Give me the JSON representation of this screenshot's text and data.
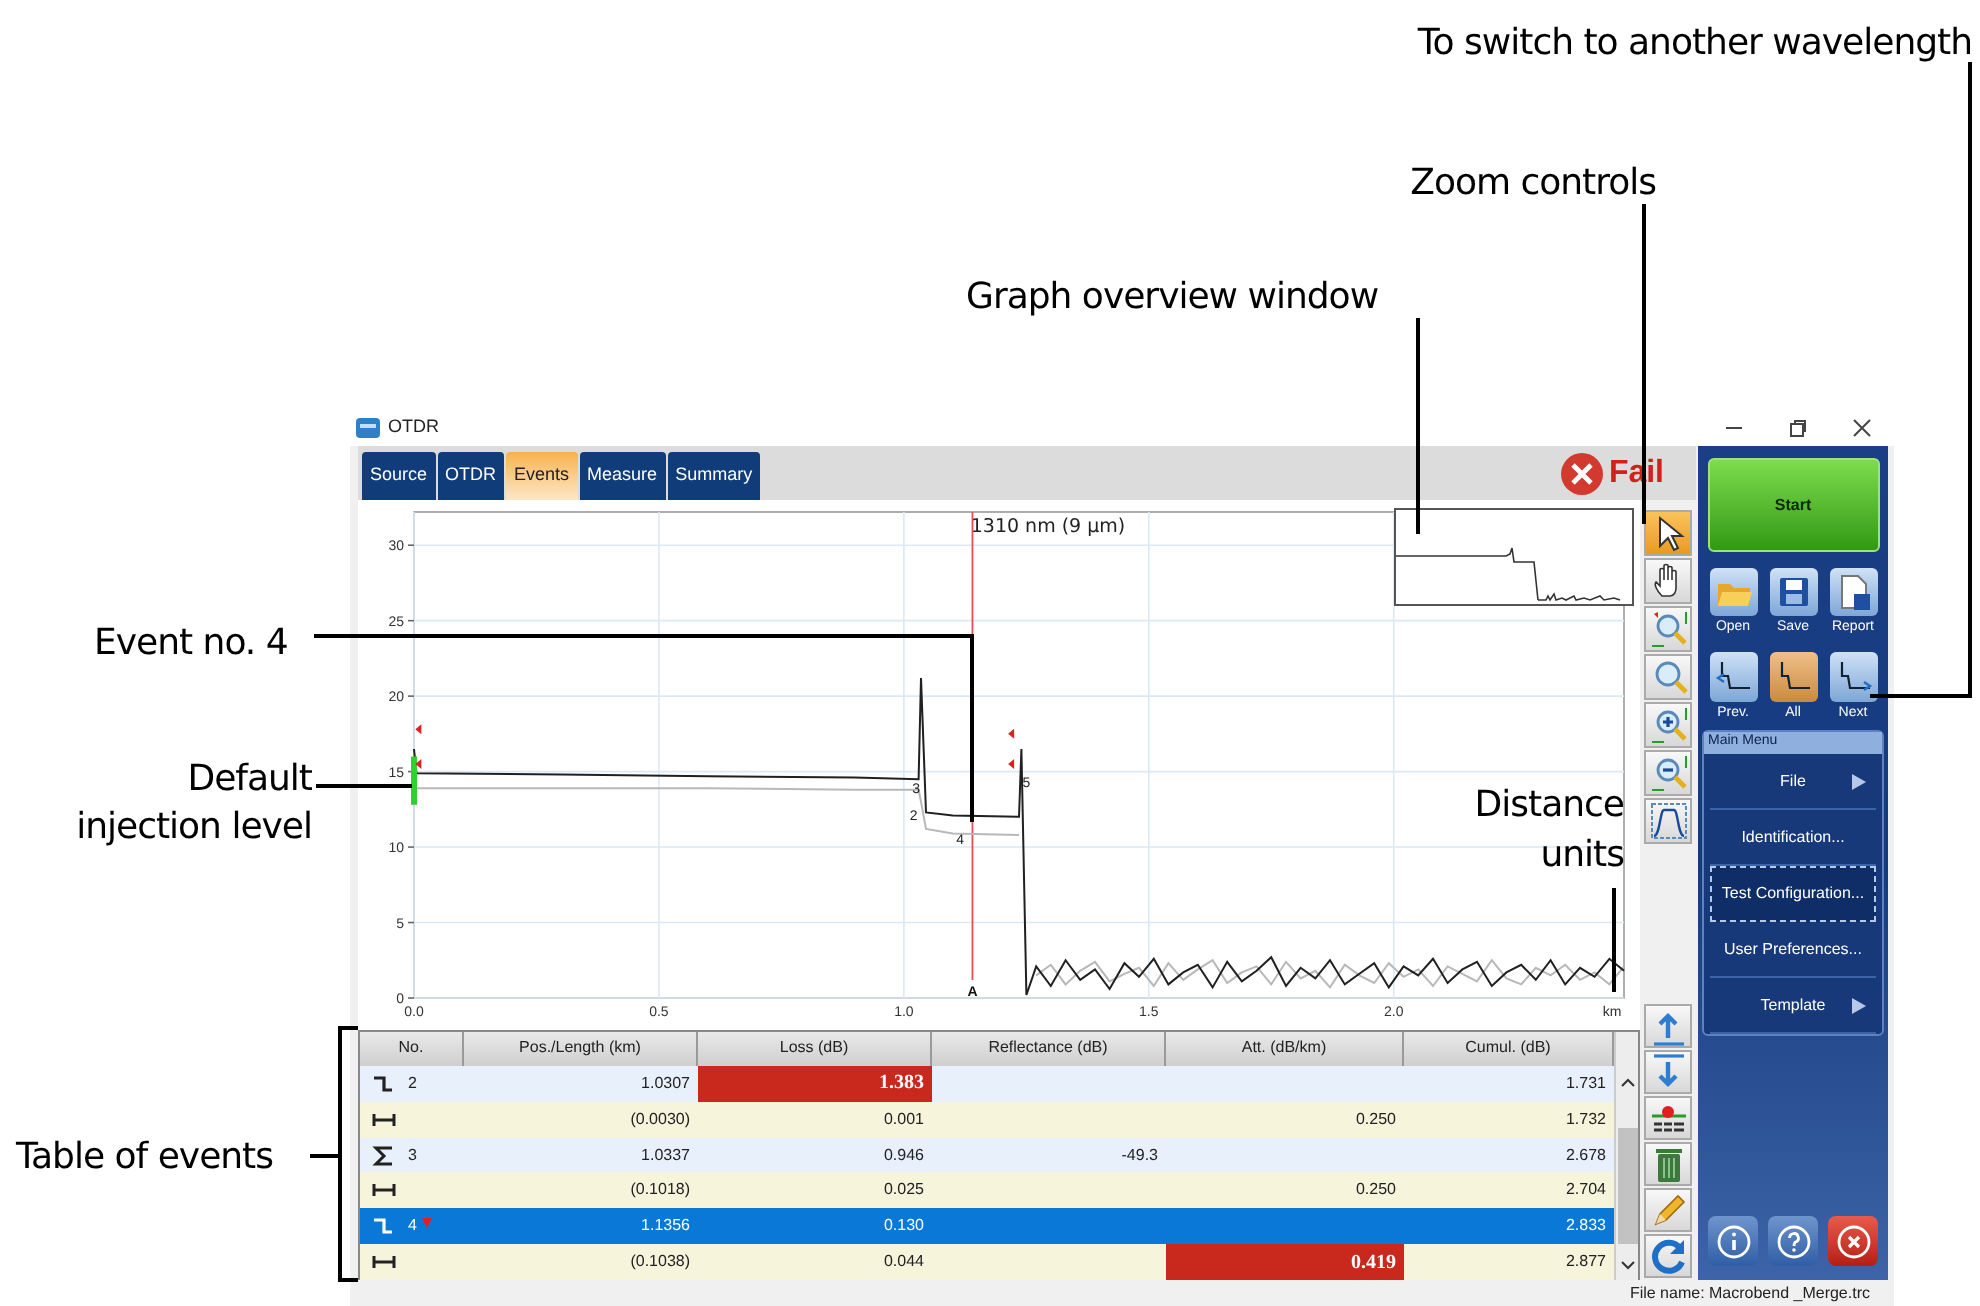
{
  "callouts": [
    {
      "kind": "wavelength",
      "text": "To switch to another wavelength"
    },
    {
      "kind": "zoom",
      "text": "Zoom controls"
    },
    {
      "kind": "overview",
      "text": "Graph overview window"
    },
    {
      "kind": "event",
      "text": "Event no. 4"
    },
    {
      "kind": "injection",
      "text": "Default injection level"
    },
    {
      "kind": "units",
      "text": "Distance units"
    },
    {
      "kind": "table",
      "text": "Table of events"
    }
  ],
  "window": {
    "title": "OTDR"
  },
  "tabs": [
    {
      "label": "Source",
      "selected": false
    },
    {
      "label": "OTDR",
      "selected": false
    },
    {
      "label": "Events",
      "selected": true
    },
    {
      "label": "Measure",
      "selected": false
    },
    {
      "label": "Summary",
      "selected": false
    }
  ],
  "status": {
    "label": "Fail"
  },
  "graph": {
    "chart_data": {
      "type": "line",
      "title": "1310 nm (9 µm)",
      "xlabel": "km",
      "xlim": [
        0,
        2.47
      ],
      "ylim": [
        0,
        32.2
      ],
      "grid": true,
      "xticks": [
        {
          "value": 0,
          "label": "0.0"
        },
        {
          "value": 0.5,
          "label": "0.5"
        },
        {
          "value": 1,
          "label": "1.0"
        },
        {
          "value": 1.5,
          "label": "1.5"
        },
        {
          "value": 2,
          "label": "2.0"
        }
      ],
      "yticks": [
        0,
        5,
        10,
        15,
        20,
        25,
        30
      ],
      "x": [
        0,
        0.005,
        0.3,
        0.6,
        0.9,
        1.03,
        1.035,
        1.045,
        1.1,
        1.235,
        1.24,
        1.25,
        1.27,
        1.3,
        1.33,
        1.36,
        1.39,
        1.42,
        1.45,
        1.48,
        1.51,
        1.54,
        1.57,
        1.6,
        1.63,
        1.66,
        1.69,
        1.72,
        1.75,
        1.78,
        1.81,
        1.84,
        1.87,
        1.9,
        1.93,
        1.96,
        1.99,
        2.02,
        2.05,
        2.08,
        2.11,
        2.14,
        2.17,
        2.2,
        2.23,
        2.26,
        2.29,
        2.32,
        2.35,
        2.38,
        2.41,
        2.44,
        2.47
      ],
      "series": [
        {
          "color": "#b8b8b8",
          "values": [
            14.0,
            13.9,
            13.9,
            13.9,
            13.8,
            13.8,
            13.0,
            11.2,
            10.9,
            10.8,
            null,
            null,
            1.5,
            2.2,
            0.9,
            1.8,
            2.4,
            1.1,
            1.6,
            2.0,
            0.8,
            2.3,
            1.2,
            1.9,
            2.5,
            1.0,
            1.7,
            2.1,
            0.9,
            2.4,
            1.3,
            1.8,
            0.7,
            2.2,
            1.5,
            1.0,
            2.3,
            1.4,
            1.9,
            0.8,
            2.1,
            1.6,
            1.1,
            2.5,
            1.3,
            0.9,
            2.0,
            1.5,
            2.2,
            1.2,
            1.7,
            0.9,
            2.1
          ]
        },
        {
          "color": "#202020",
          "values": [
            16.5,
            14.9,
            14.8,
            14.7,
            14.6,
            14.5,
            21.2,
            12.3,
            12.1,
            12.0,
            16.5,
            0.2,
            2.1,
            0.8,
            2.5,
            1.2,
            1.9,
            0.6,
            2.3,
            1.4,
            2.6,
            0.9,
            1.7,
            2.2,
            0.7,
            2.4,
            1.1,
            1.8,
            2.7,
            0.8,
            2.0,
            1.3,
            2.5,
            0.9,
            1.6,
            2.3,
            0.7,
            2.1,
            1.5,
            2.6,
            1.0,
            1.9,
            2.4,
            0.8,
            1.7,
            2.2,
            1.2,
            2.5,
            0.9,
            2.0,
            1.4,
            2.6,
            1.8
          ]
        }
      ],
      "ref_lines": [
        {
          "axis": "x",
          "value": 1.14,
          "label": "A",
          "color": "#e05050"
        }
      ],
      "annotations": [
        {
          "x": 1.02,
          "y": 11.8,
          "text": "2"
        },
        {
          "x": 1.025,
          "y": 13.6,
          "text": "3"
        },
        {
          "x": 1.115,
          "y": 10.2,
          "text": "4"
        },
        {
          "x": 1.25,
          "y": 14.0,
          "text": "5"
        }
      ]
    }
  },
  "zoom_tools": [
    {
      "kind": "pointer",
      "selected": true
    },
    {
      "kind": "hand",
      "selected": false
    },
    {
      "kind": "zoom-area",
      "selected": false
    },
    {
      "kind": "zoom-reset",
      "selected": false
    },
    {
      "kind": "zoom-in",
      "selected": false
    },
    {
      "kind": "zoom-out",
      "selected": false
    },
    {
      "kind": "full-view",
      "selected": false
    }
  ],
  "table_tools": [
    {
      "kind": "up"
    },
    {
      "kind": "down"
    },
    {
      "kind": "insert"
    },
    {
      "kind": "delete"
    },
    {
      "kind": "edit"
    },
    {
      "kind": "refresh"
    }
  ],
  "events_table": {
    "columns": [
      "No.",
      "Pos./Length (km)",
      "Loss (dB)",
      "Reflectance (dB)",
      "Att. (dB/km)",
      "Cumul. (dB)"
    ],
    "rows": [
      {
        "kind": "step",
        "number": "2",
        "flagged": false,
        "selected": false,
        "cells": [
          {
            "text": "1.0307",
            "fail": false
          },
          {
            "text": "1.383",
            "fail": true
          },
          null,
          null,
          {
            "text": "1.731",
            "fail": false
          }
        ]
      },
      {
        "kind": "span",
        "flagged": false,
        "selected": false,
        "cells": [
          {
            "text": "(0.0030)",
            "fail": false
          },
          {
            "text": "0.001",
            "fail": false
          },
          null,
          {
            "text": "0.250",
            "fail": false
          },
          {
            "text": "1.732",
            "fail": false
          }
        ]
      },
      {
        "kind": "merged",
        "number": "3",
        "flagged": false,
        "selected": false,
        "cells": [
          {
            "text": "1.0337",
            "fail": false
          },
          {
            "text": "0.946",
            "fail": false
          },
          {
            "text": "-49.3",
            "fail": false
          },
          null,
          {
            "text": "2.678",
            "fail": false
          }
        ]
      },
      {
        "kind": "span",
        "flagged": false,
        "selected": false,
        "cells": [
          {
            "text": "(0.1018)",
            "fail": false
          },
          {
            "text": "0.025",
            "fail": false
          },
          null,
          {
            "text": "0.250",
            "fail": false
          },
          {
            "text": "2.704",
            "fail": false
          }
        ]
      },
      {
        "kind": "step",
        "number": "4",
        "flagged": true,
        "selected": true,
        "cells": [
          {
            "text": "1.1356",
            "fail": false
          },
          {
            "text": "0.130",
            "fail": false
          },
          null,
          null,
          {
            "text": "2.833",
            "fail": false
          }
        ]
      },
      {
        "kind": "span",
        "flagged": false,
        "selected": false,
        "cells": [
          {
            "text": "(0.1038)",
            "fail": false
          },
          {
            "text": "0.044",
            "fail": false
          },
          null,
          {
            "text": "0.419",
            "fail": true
          },
          {
            "text": "2.877",
            "fail": false
          }
        ]
      }
    ]
  },
  "side_panel": {
    "start": "Start",
    "file_actions": [
      {
        "kind": "open",
        "label": "Open"
      },
      {
        "kind": "save",
        "label": "Save"
      },
      {
        "kind": "report",
        "label": "Report"
      }
    ],
    "wavelengths": [
      {
        "kind": "prev",
        "label": "Prev.",
        "selected": false
      },
      {
        "kind": "all",
        "label": "All",
        "selected": true
      },
      {
        "kind": "next",
        "label": "Next",
        "selected": false
      }
    ],
    "menu_title": "Main Menu",
    "menu": [
      {
        "label": "File",
        "submenu": true,
        "focused": false
      },
      {
        "label": "Identification...",
        "submenu": false,
        "focused": false
      },
      {
        "label": "Test Configuration...",
        "submenu": false,
        "focused": true
      },
      {
        "label": "User Preferences...",
        "submenu": false,
        "focused": false
      },
      {
        "label": "Template",
        "submenu": true,
        "focused": false
      }
    ],
    "bottom": [
      {
        "kind": "info"
      },
      {
        "kind": "help"
      },
      {
        "kind": "exit"
      }
    ]
  },
  "status_bar": {
    "file": "File name: Macrobend _Merge.trc"
  }
}
